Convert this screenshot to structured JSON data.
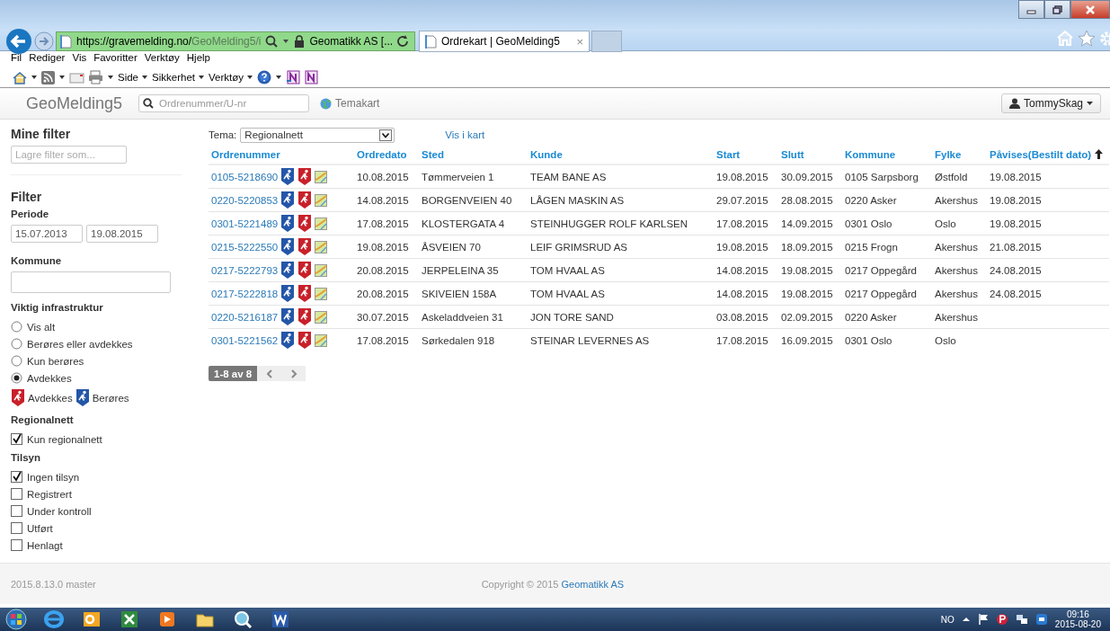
{
  "browser": {
    "address_host": "https://gravemelding.no/",
    "address_path": "GeoMelding5/i",
    "certificate": "Geomatikk AS [...",
    "tabs": [
      {
        "label": "Ordrekart | GeoMelding5",
        "selected": true,
        "close": "×"
      }
    ],
    "menu": [
      "Fil",
      "Rediger",
      "Vis",
      "Favoritter",
      "Verktøy",
      "Hjelp"
    ],
    "command_bar": [
      "Side",
      "Sikkerhet",
      "Verktøy"
    ]
  },
  "navbar": {
    "brand": "GeoMelding5",
    "search": {
      "placeholder": "Ordrenummer/U-nr"
    },
    "theme_link": "Temakart",
    "user": "TommySkag"
  },
  "sidebar": {
    "saved_title": "Mine filter",
    "saved_field": {
      "placeholder": "Lagre filter som..."
    },
    "filter_title": "Filter",
    "period_label": "Periode",
    "period_from": "15.07.2013",
    "period_to": "19.08.2015",
    "municipality_label": "Kommune",
    "infra_label": "Viktig infrastruktur",
    "infra_options": [
      {
        "label": "Vis alt",
        "selected": false
      },
      {
        "label": "Berøres eller avdekkes",
        "selected": false
      },
      {
        "label": "Kun berøres",
        "selected": false
      },
      {
        "label": "Avdekkes",
        "selected": true
      }
    ],
    "legend": [
      {
        "label": "Avdekkes",
        "color": "#c8202a"
      },
      {
        "label": "Berøres",
        "color": "#2456a8"
      }
    ],
    "regional_label": "Regionalnett",
    "regional_options": [
      {
        "label": "Kun regionalnett",
        "checked": true
      }
    ],
    "inspection_label": "Tilsyn",
    "inspection_options": [
      {
        "label": "Ingen tilsyn",
        "checked": true
      },
      {
        "label": "Registrert",
        "checked": false
      },
      {
        "label": "Under kontroll",
        "checked": false
      },
      {
        "label": "Utført",
        "checked": false
      },
      {
        "label": "Henlagt",
        "checked": false
      }
    ]
  },
  "main": {
    "theme_label": "Tema:",
    "theme_value": "Regionalnett",
    "map_link": "Vis i kart",
    "columns": [
      {
        "label": "Ordrenummer",
        "sorted": false
      },
      {
        "label": "Ordredato",
        "sorted": false
      },
      {
        "label": "Sted",
        "sorted": false
      },
      {
        "label": "Kunde",
        "sorted": false
      },
      {
        "label": "Start",
        "sorted": false
      },
      {
        "label": "Slutt",
        "sorted": false
      },
      {
        "label": "Kommune",
        "sorted": false
      },
      {
        "label": "Fylke",
        "sorted": false
      },
      {
        "label": "Påvises(Bestilt dato)",
        "sorted": true
      }
    ],
    "rows": [
      {
        "cells": [
          "0105-5218690",
          "10.08.2015",
          "Tømmerveien 1",
          "TEAM BANE AS",
          "19.08.2015",
          "30.09.2015",
          "0105 Sarpsborg",
          "Østfold",
          "19.08.2015"
        ]
      },
      {
        "cells": [
          "0220-5220853",
          "14.08.2015",
          "BORGENVEIEN 40",
          "LÅGEN MASKIN AS",
          "29.07.2015",
          "28.08.2015",
          "0220 Asker",
          "Akershus",
          "19.08.2015"
        ]
      },
      {
        "cells": [
          "0301-5221489",
          "17.08.2015",
          "KLOSTERGATA 4",
          "STEINHUGGER ROLF KARLSEN",
          "17.08.2015",
          "14.09.2015",
          "0301 Oslo",
          "Oslo",
          "19.08.2015"
        ]
      },
      {
        "cells": [
          "0215-5222550",
          "19.08.2015",
          "ÅSVEIEN 70",
          "LEIF GRIMSRUD AS",
          "19.08.2015",
          "18.09.2015",
          "0215 Frogn",
          "Akershus",
          "21.08.2015"
        ]
      },
      {
        "cells": [
          "0217-5222793",
          "20.08.2015",
          "JERPELEINA 35",
          "TOM HVAAL AS",
          "14.08.2015",
          "19.08.2015",
          "0217 Oppegård",
          "Akershus",
          "24.08.2015"
        ]
      },
      {
        "cells": [
          "0217-5222818",
          "20.08.2015",
          "SKIVEIEN 158A",
          "TOM HVAAL AS",
          "14.08.2015",
          "19.08.2015",
          "0217 Oppegård",
          "Akershus",
          "24.08.2015"
        ]
      },
      {
        "cells": [
          "0220-5216187",
          "30.07.2015",
          "Askeladdveien 31",
          "JON TORE SAND",
          "03.08.2015",
          "02.09.2015",
          "0220 Asker",
          "Akershus"
        ]
      },
      {
        "cells": [
          "0301-5221562",
          "17.08.2015",
          "Sørkedalen 918",
          "STEINAR LEVERNES AS",
          "17.08.2015",
          "16.09.2015",
          "0301 Oslo",
          "Oslo"
        ]
      }
    ],
    "pager": "1-8 av 8"
  },
  "footer": {
    "version": "2015.8.13.0 master",
    "copyright": "Copyright © 2015",
    "company_link": "Geomatikk AS"
  },
  "taskbar": {
    "language": "NO",
    "time": "09:16",
    "date": "2015-08-20"
  }
}
